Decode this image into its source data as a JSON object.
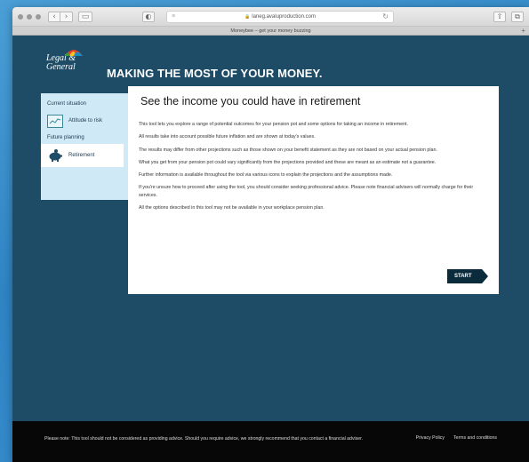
{
  "browser": {
    "url": "laneg.avaluproduction.com",
    "tab_title": "Moneybee – get your money buzzing",
    "back_icon": "chevron-left-icon",
    "forward_icon": "chevron-right-icon"
  },
  "brand": {
    "logo_line1": "Legal &",
    "logo_line2": "General"
  },
  "header": {
    "headline": "MAKING THE MOST OF YOUR MONEY."
  },
  "sidebar": {
    "section1_label": "Current situation",
    "item1_label": "Attitude to risk",
    "section2_label": "Future planning",
    "item2_label": "Retirement"
  },
  "main": {
    "title": "See the income you could have in retirement",
    "paragraphs": [
      "This tool lets you explore a range of potential outcomes for your pension pot and some options for taking an income in retirement.",
      "All results take into account possible future inflation and are shown at today's values.",
      "The results may differ from other projections such as those shown on your benefit statement as they are not based on your actual pension plan.",
      "What you get from your pension pot could vary significantly from the projections provided and these are meant as an estimate not a guarantee.",
      "Further information is available throughout the tool via various icons to explain the projections and the assumptions made.",
      "If you're unsure how to proceed after using the tool, you should consider seeking professional advice. Please note financial advisers will normally charge for their services.",
      "All the options described in this tool may not be available in your workplace pension plan."
    ],
    "start_label": "START"
  },
  "footer": {
    "note": "Please note: This tool should not be considered as providing advice. Should you require advice, we strongly recommend that you contact a financial adviser.",
    "privacy_label": "Privacy Policy",
    "terms_label": "Terms and conditions"
  }
}
